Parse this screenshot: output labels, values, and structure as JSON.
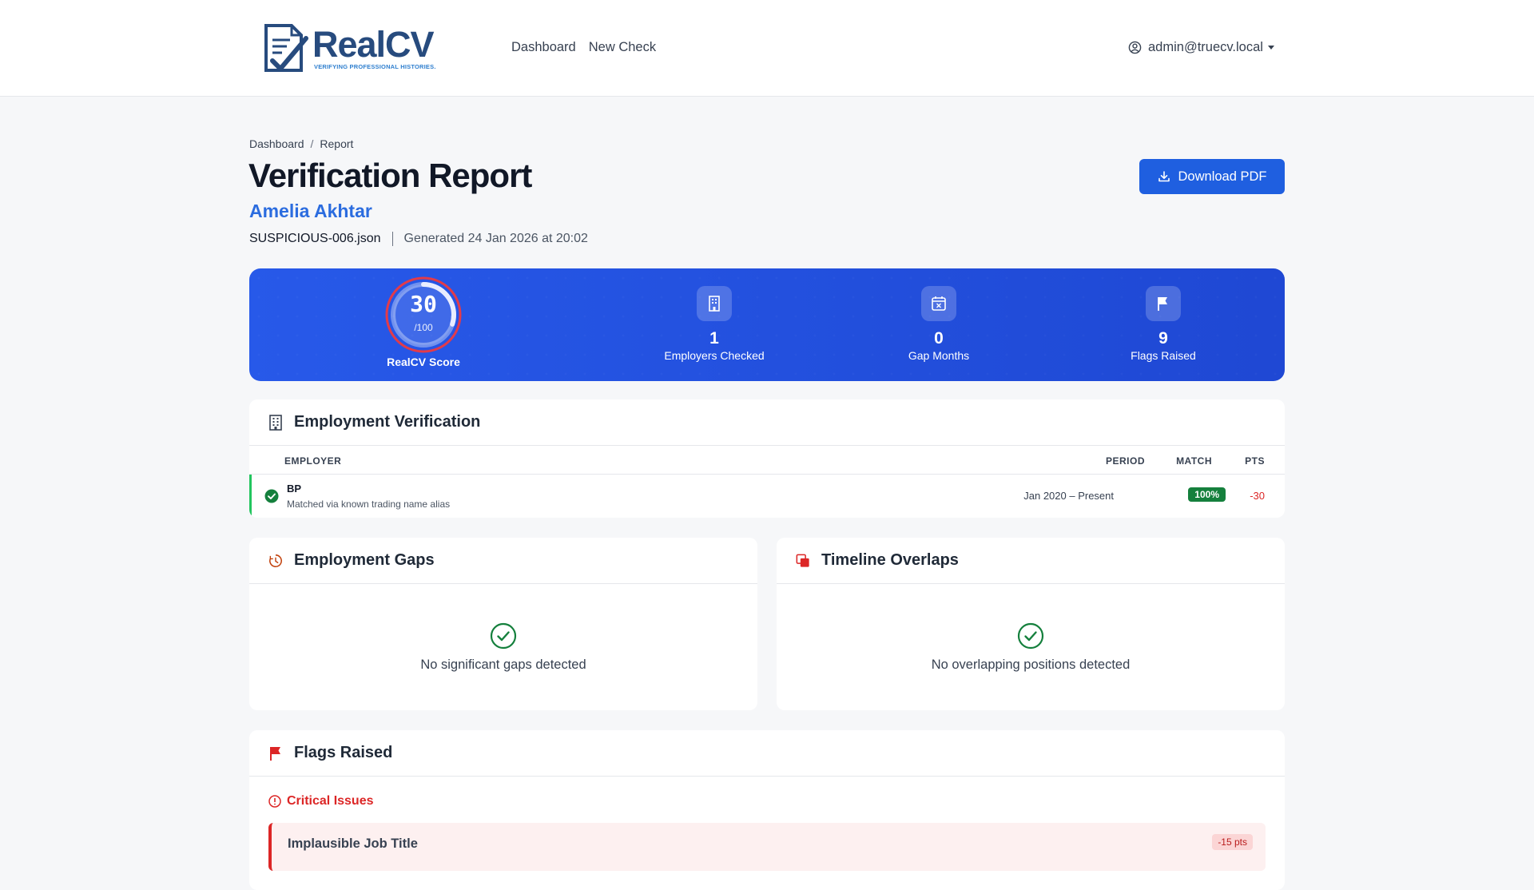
{
  "brand": {
    "name": "RealCV",
    "tagline": "VERIFYING PROFESSIONAL HISTORIES."
  },
  "nav": {
    "links": [
      "Dashboard",
      "New Check"
    ],
    "user": "admin@truecv.local"
  },
  "breadcrumb": [
    "Dashboard",
    "Report"
  ],
  "report": {
    "title": "Verification Report",
    "candidate": "Amelia Akhtar",
    "file": "SUSPICIOUS-006.json",
    "generated": "Generated 24 Jan 2026 at 20:02",
    "download_label": "Download PDF"
  },
  "summary": {
    "score": "30",
    "score_max": "/100",
    "score_value": 0.3,
    "score_label": "RealCV Score",
    "stats": [
      {
        "value": "1",
        "label": "Employers Checked",
        "icon": "building-icon"
      },
      {
        "value": "0",
        "label": "Gap Months",
        "icon": "calendar-icon"
      },
      {
        "value": "9",
        "label": "Flags Raised",
        "icon": "flag-icon"
      }
    ]
  },
  "employment": {
    "title": "Employment Verification",
    "columns": {
      "employer": "EMPLOYER",
      "period": "PERIOD",
      "match": "MATCH",
      "pts": "PTS"
    },
    "rows": [
      {
        "employer": "BP",
        "note": "Matched via known trading name alias",
        "period": "Jan 2020 – Present",
        "match": "100%",
        "pts": "-30",
        "status": "verified"
      }
    ]
  },
  "gaps": {
    "title": "Employment Gaps",
    "empty": "No significant gaps detected"
  },
  "overlaps": {
    "title": "Timeline Overlaps",
    "empty": "No overlapping positions detected"
  },
  "flags": {
    "title": "Flags Raised",
    "critical_heading": "Critical Issues",
    "items": [
      {
        "title": "Implausible Job Title",
        "pts": "-15 pts"
      }
    ]
  },
  "colors": {
    "primary": "#1f5fe0",
    "danger": "#dc2626",
    "success": "#15803d",
    "brand": "#274b7e"
  }
}
